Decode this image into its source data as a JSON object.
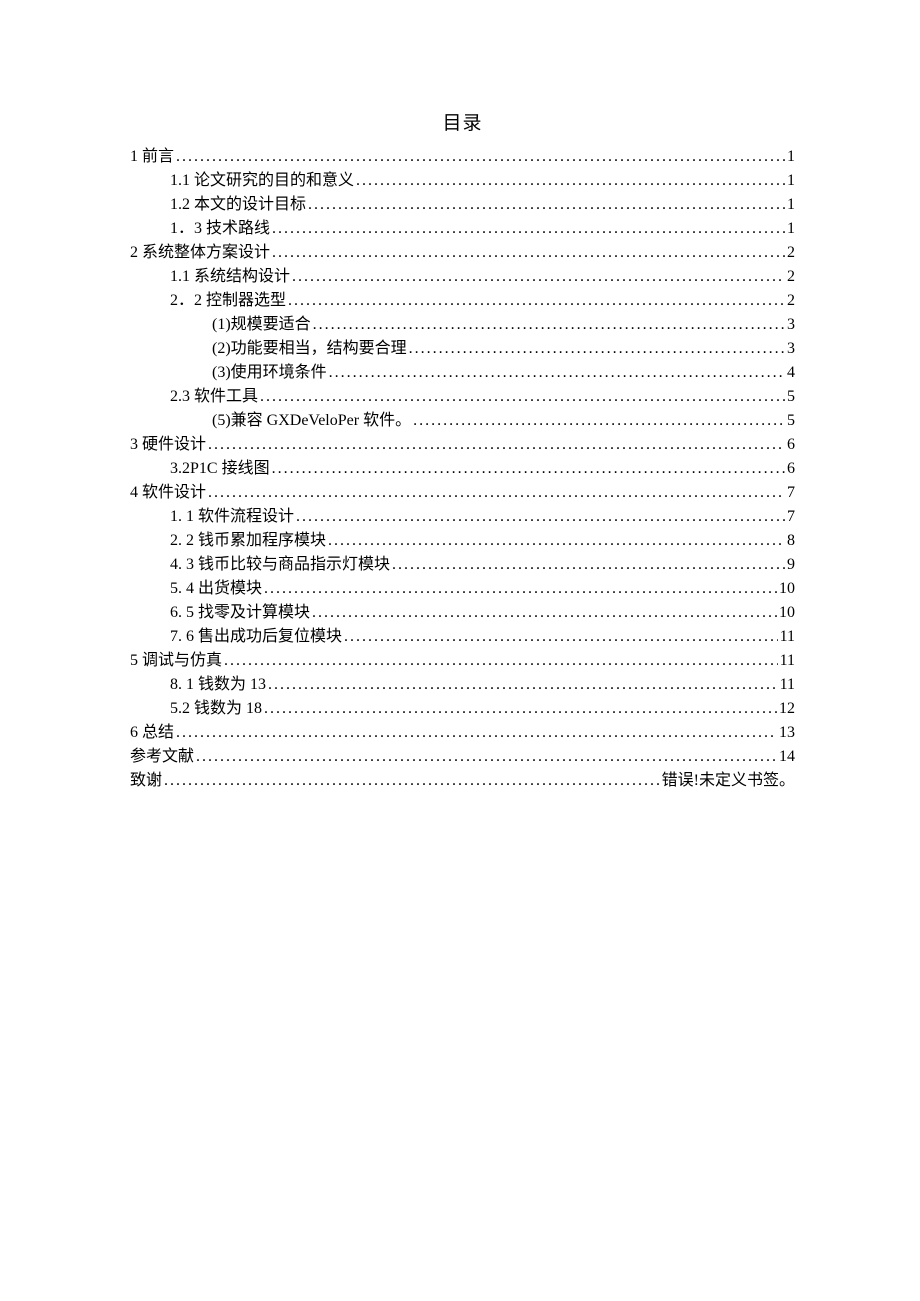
{
  "title": "目录",
  "toc": [
    {
      "indent": 0,
      "label": "1 前言",
      "page": "1"
    },
    {
      "indent": 1,
      "label": "1.1  论文研究的目的和意义",
      "page": "1"
    },
    {
      "indent": 1,
      "label": "1.2  本文的设计目标",
      "page": "1"
    },
    {
      "indent": 1,
      "label": "1．3 技术路线",
      "page": "1"
    },
    {
      "indent": 0,
      "label": "2 系统整体方案设计",
      "page": "2"
    },
    {
      "indent": 1,
      "label": "1.1  系统结构设计",
      "page": "2"
    },
    {
      "indent": 1,
      "label": "2．2 控制器选型",
      "page": "2"
    },
    {
      "indent": 2,
      "label": "(1)规模要适合",
      "page": "3"
    },
    {
      "indent": 2,
      "label": "(2)功能要相当，结构要合理",
      "page": "3"
    },
    {
      "indent": 2,
      "label": "(3)使用环境条件",
      "page": "4"
    },
    {
      "indent": 1,
      "label": "2.3 软件工具",
      "page": "5"
    },
    {
      "indent": 2,
      "label": "(5)兼容 GXDeVeloPer 软件。",
      "page": "5"
    },
    {
      "indent": 0,
      "label": "3 硬件设计",
      "page": "6"
    },
    {
      "indent": 1,
      "label": "3.2P1C 接线图",
      "page": "6"
    },
    {
      "indent": 0,
      "label": "4 软件设计",
      "page": "7"
    },
    {
      "indent": 1,
      "label": "1. 1 软件流程设计",
      "page": "7"
    },
    {
      "indent": 1,
      "label": "2. 2 钱币累加程序模块",
      "page": "8"
    },
    {
      "indent": 1,
      "label": "4. 3 钱币比较与商品指示灯模块",
      "page": "9"
    },
    {
      "indent": 1,
      "label": "5. 4 出货模块",
      "page": "10"
    },
    {
      "indent": 1,
      "label": "6. 5 找零及计算模块",
      "page": "10"
    },
    {
      "indent": 1,
      "label": "7. 6 售出成功后复位模块",
      "page": "11"
    },
    {
      "indent": 0,
      "label": "5 调试与仿真",
      "page": "11"
    },
    {
      "indent": 1,
      "label": "8. 1 钱数为 13",
      "page": "11"
    },
    {
      "indent": 1,
      "label": "5.2 钱数为 18",
      "page": "12"
    },
    {
      "indent": 0,
      "label": "6 总结",
      "page": "13"
    },
    {
      "indent": 0,
      "label": "参考文献",
      "page": "14"
    },
    {
      "indent": 0,
      "label": "致谢",
      "page": "错误!未定义书签。"
    }
  ]
}
